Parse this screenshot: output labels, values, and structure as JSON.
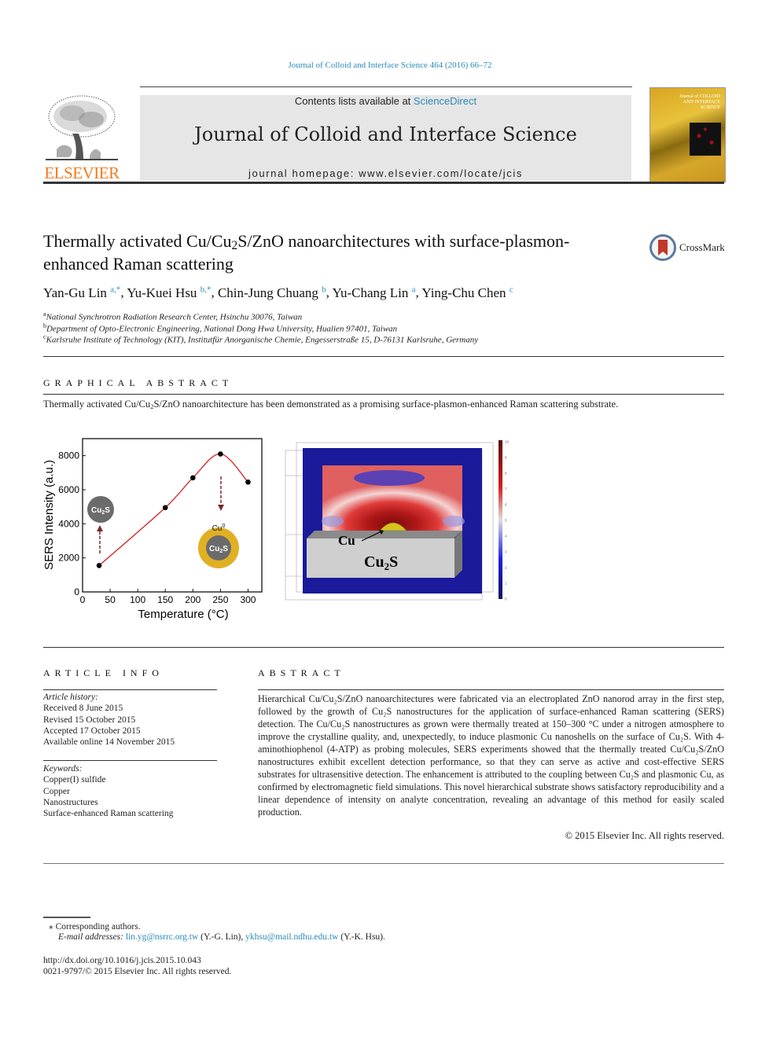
{
  "header": {
    "citation": "Journal of Colloid and Interface Science 464 (2016) 66–72",
    "publisher": "ELSEVIER",
    "contents_prefix": "Contents lists available at ",
    "contents_link": "ScienceDirect",
    "journal_title": "Journal of Colloid and Interface Science",
    "homepage": "journal homepage: www.elsevier.com/locate/jcis",
    "cover_title": "Journal of COLLOID AND INTERFACE SCIENCE"
  },
  "article": {
    "title_part1": "Thermally activated Cu/Cu",
    "title_sub": "2",
    "title_part2": "S/ZnO nanoarchitectures with surface-plasmon-enhanced Raman scattering",
    "crossmark": "CrossMark",
    "authors": [
      {
        "name": "Yan-Gu Lin",
        "sup": "a,*"
      },
      {
        "name": "Yu-Kuei Hsu",
        "sup": "b,*"
      },
      {
        "name": "Chin-Jung Chuang",
        "sup": "b"
      },
      {
        "name": "Yu-Chang Lin",
        "sup": "a"
      },
      {
        "name": "Ying-Chu Chen",
        "sup": "c"
      }
    ],
    "affiliations": [
      {
        "sup": "a",
        "text": "National Synchrotron Radiation Research Center, Hsinchu 30076, Taiwan"
      },
      {
        "sup": "b",
        "text": "Department of Opto-Electronic Engineering, National Dong Hwa University, Hualien 97401, Taiwan"
      },
      {
        "sup": "c",
        "text": "Karlsruhe Institute of Technology (KIT), Institutfür Anorganische Chemie, Engesserstraße 15, D-76131 Karlsruhe, Germany"
      }
    ]
  },
  "graphical_abstract": {
    "heading": "GRAPHICAL ABSTRACT",
    "text_part1": "Thermally activated Cu/Cu",
    "text_sub": "2",
    "text_part2": "S/ZnO nanoarchitecture has been demonstrated as a promising surface-plasmon-enhanced Raman scattering substrate.",
    "sim_labels": {
      "cu": "Cu",
      "cu2s": "Cu",
      "cu2s_sub": "2",
      "cu2s_s": "S"
    },
    "colorbar_ticks": [
      "10",
      "9",
      "8",
      "7",
      "6",
      "5",
      "4",
      "3",
      "2",
      "1",
      "0"
    ]
  },
  "chart_data": {
    "type": "line",
    "title": "",
    "xlabel": "Temperature (°C)",
    "ylabel": "SERS Intensity (a.u.)",
    "x": [
      30,
      150,
      200,
      250,
      300
    ],
    "series": [
      {
        "name": "SERS Intensity",
        "values": [
          1550,
          4950,
          6700,
          8100,
          6450
        ],
        "color": "#d42020"
      }
    ],
    "xlim": [
      0,
      325
    ],
    "ylim": [
      0,
      9000
    ],
    "xticks": [
      0,
      50,
      100,
      150,
      200,
      250,
      300
    ],
    "yticks": [
      0,
      2000,
      4000,
      6000,
      8000
    ],
    "grid": false,
    "annotations": [
      {
        "text": "Cu2S",
        "kind": "particle",
        "near_x": 30
      },
      {
        "text": "Cu0 / Cu2S",
        "kind": "core-shell particle",
        "near_x": 250
      }
    ]
  },
  "article_info": {
    "heading": "ARTICLE INFO",
    "history_label": "Article history:",
    "history": [
      "Received 8 June 2015",
      "Revised 15 October 2015",
      "Accepted 17 October 2015",
      "Available online 14 November 2015"
    ],
    "keywords_label": "Keywords:",
    "keywords": [
      "Copper(I) sulfide",
      "Copper",
      "Nanostructures",
      "Surface-enhanced Raman scattering"
    ]
  },
  "abstract": {
    "heading": "ABSTRACT",
    "text": "Hierarchical Cu/Cu₂S/ZnO nanoarchitectures were fabricated via an electroplated ZnO nanorod array in the first step, followed by the growth of Cu₂S nanostructures for the application of surface-enhanced Raman scattering (SERS) detection. The Cu/Cu₂S nanostructures as grown were thermally treated at 150–300 °C under a nitrogen atmosphere to improve the crystalline quality, and, unexpectedly, to induce plasmonic Cu nanoshells on the surface of Cu₂S. With 4-aminothiophenol (4-ATP) as probing molecules, SERS experiments showed that the thermally treated Cu/Cu₂S/ZnO nanostructures exhibit excellent detection performance, so that they can serve as active and cost-effective SERS substrates for ultrasensitive detection. The enhancement is attributed to the coupling between Cu₂S and plasmonic Cu, as confirmed by electromagnetic field simulations. This novel hierarchical substrate shows satisfactory reproducibility and a linear dependence of intensity on analyte concentration, revealing an advantage of this method for easily scaled production.",
    "copyright": "© 2015 Elsevier Inc. All rights reserved."
  },
  "footnotes": {
    "corresponding": "⁎ Corresponding authors.",
    "email_label": "E-mail addresses: ",
    "email1": "lin.yg@nsrrc.org.tw",
    "email1_who": " (Y.-G. Lin), ",
    "email2": "ykhsu@mail.ndhu.edu.tw",
    "email2_who": " (Y.-K. Hsu).",
    "doi": "http://dx.doi.org/10.1016/j.jcis.2015.10.043",
    "issn": "0021-9797/© 2015 Elsevier Inc. All rights reserved."
  }
}
